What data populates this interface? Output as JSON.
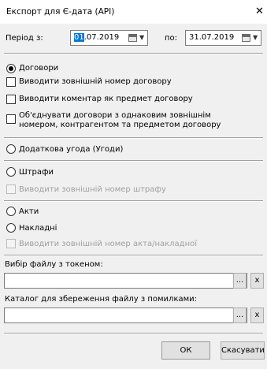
{
  "window": {
    "title": "Експорт для Є-дата (API)",
    "close_glyph": "✕"
  },
  "period": {
    "label": "Період з:",
    "from_day": "01",
    "from_rest": ".07.2019",
    "to_label": "по:",
    "to_value": "31.07.2019"
  },
  "options": {
    "contracts": {
      "label": "Договори",
      "selected": true
    },
    "contracts_ext_number": "Виводити зовнішній номер договору",
    "contracts_comment": "Виводити коментар як предмет договору",
    "contracts_merge_line1": "Об'єднувати договори з однаковим зовнішнім",
    "contracts_merge_line2": "номером, контрагентом та предметом договору",
    "supplementary": {
      "label": "Додаткова угода (Угоди)",
      "selected": false
    },
    "fines": {
      "label": "Штрафи",
      "selected": false
    },
    "fines_ext_number": "Виводити зовнішній номер штрафу",
    "acts": {
      "label": "Акти",
      "selected": false
    },
    "invoices": {
      "label": "Накладні",
      "selected": false
    },
    "acts_ext_number": "Виводити зовнішній номер акта/накладної"
  },
  "token_file": {
    "label": "Вибір файлу з токеном:",
    "value": "",
    "browse": "...",
    "clear": "x"
  },
  "error_dir": {
    "label": "Каталог для збереження файлу з помилками:",
    "value": "",
    "browse": "...",
    "clear": "x"
  },
  "buttons": {
    "ok": "ОК",
    "cancel": "Скасувати"
  }
}
